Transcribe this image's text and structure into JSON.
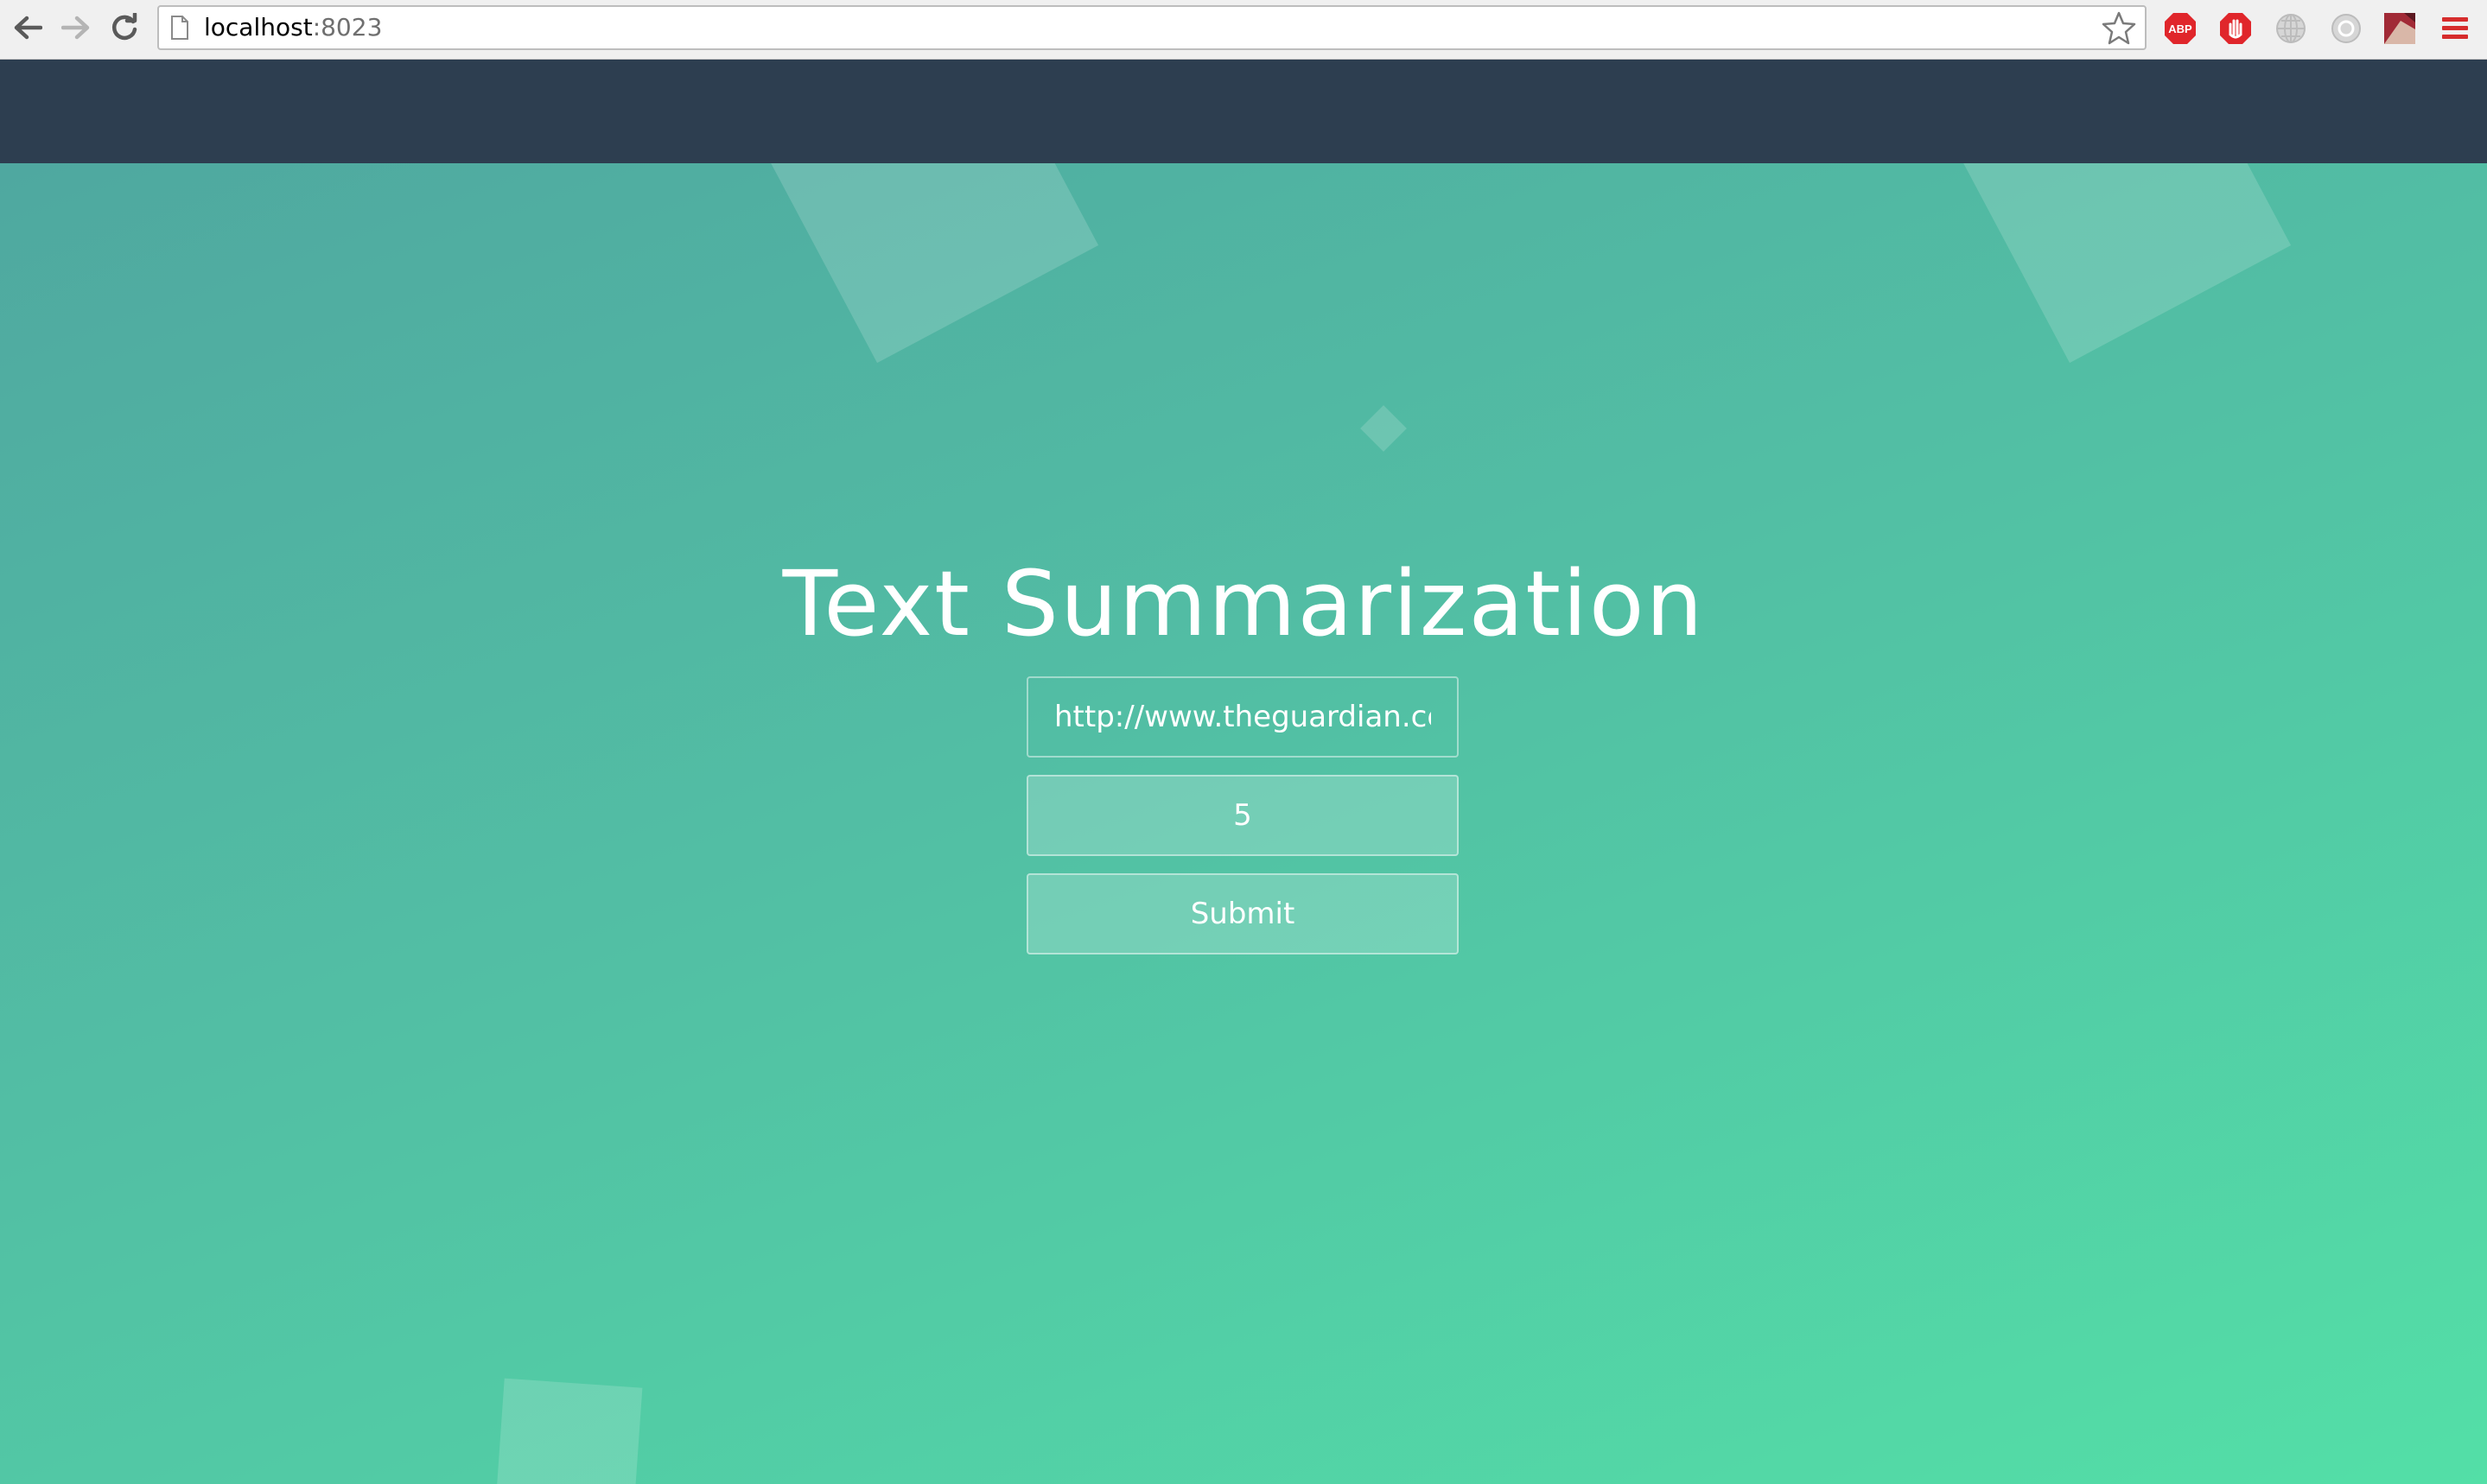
{
  "browser": {
    "url_host": "localhost",
    "url_port": ":8023",
    "back_icon": "back-arrow-icon",
    "forward_icon": "forward-arrow-icon",
    "reload_icon": "reload-icon",
    "bookmark_icon": "star-icon",
    "extensions": [
      {
        "name": "adblock-plus-icon",
        "label": "ABP",
        "color": "#e0262b"
      },
      {
        "name": "stop-hand-icon",
        "color": "#e0262b"
      },
      {
        "name": "globe-icon",
        "color": "#bcbcbc"
      },
      {
        "name": "circle-extension-icon",
        "color": "#bcbcbc"
      },
      {
        "name": "profile-image-icon",
        "color": "#a12a36"
      },
      {
        "name": "menu-icon",
        "color": "#d62c2c"
      }
    ]
  },
  "navbar": {
    "color": "#2d3e50"
  },
  "main": {
    "title": "Text Summarization",
    "url_field": {
      "value": "http://www.theguardian.com/"
    },
    "sentences_field": {
      "value": "5"
    },
    "submit_label": "Submit"
  },
  "colors": {
    "gradient_start": "#4fa8a0",
    "gradient_end": "#53dfa7",
    "text": "#ffffff"
  }
}
